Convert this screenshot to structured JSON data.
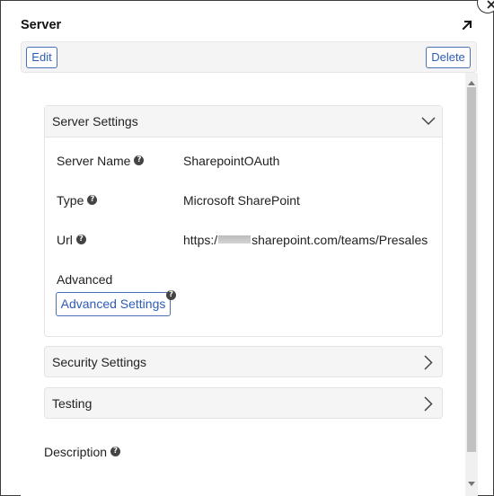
{
  "dialog": {
    "title": "Server"
  },
  "toolbar": {
    "edit_label": "Edit",
    "delete_label": "Delete"
  },
  "server_settings": {
    "header": "Server Settings",
    "expanded": true,
    "fields": {
      "server_name": {
        "label": "Server Name",
        "value": "SharepointOAuth"
      },
      "type": {
        "label": "Type",
        "value": "Microsoft SharePoint"
      },
      "url": {
        "label": "Url",
        "value_prefix": "https:/",
        "value_suffix": "sharepoint.com/teams/Presales"
      },
      "advanced": {
        "label": "Advanced",
        "button_label": "Advanced Settings"
      }
    }
  },
  "security_settings": {
    "header": "Security Settings",
    "expanded": false
  },
  "testing": {
    "header": "Testing",
    "expanded": false
  },
  "description": {
    "label": "Description"
  },
  "icons": {
    "close": "close-icon",
    "expand": "expand-arrow-icon",
    "help": "help-icon",
    "chevron_down": "chevron-down-icon",
    "chevron_right": "chevron-right-icon"
  },
  "colors": {
    "accent": "#2e5cb8",
    "button_border": "#4a6fb5",
    "panel_header_bg": "#f5f5f5"
  }
}
